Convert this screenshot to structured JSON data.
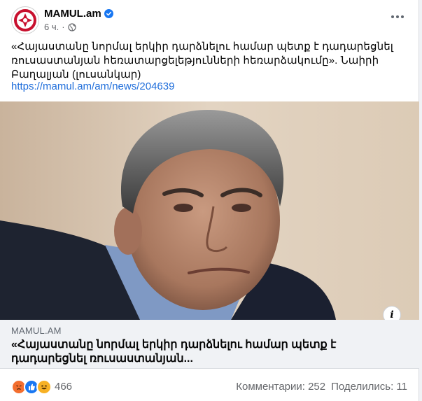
{
  "post": {
    "page_name": "MAMUL.am",
    "time": "6 ч.",
    "separator": "·",
    "text": "«Հայաստանը նորմալ երկիր դարձնելու համար պետք է դադարեցնել ռուսաստանյան հեռատարցելեթյունների հեռարձակումը». Նաիրի Բաղալյան (լուսանկար)",
    "link": "https://mamul.am/am/news/204639",
    "preview": {
      "domain": "MAMUL.AM",
      "title": "«Հայաստանը նորմալ երկիր դարձնելու համար պետք է դադարեցնել ռուսաստանյան..."
    },
    "reactions": {
      "count": "466",
      "icons": [
        "angry-icon",
        "like-icon",
        "haha-icon"
      ]
    },
    "comments": "Комментарии: 252",
    "shares": "Поделились: 11"
  },
  "colors": {
    "link": "#216fdb",
    "verified": "#1877f2",
    "secondary_text": "#65676b"
  }
}
